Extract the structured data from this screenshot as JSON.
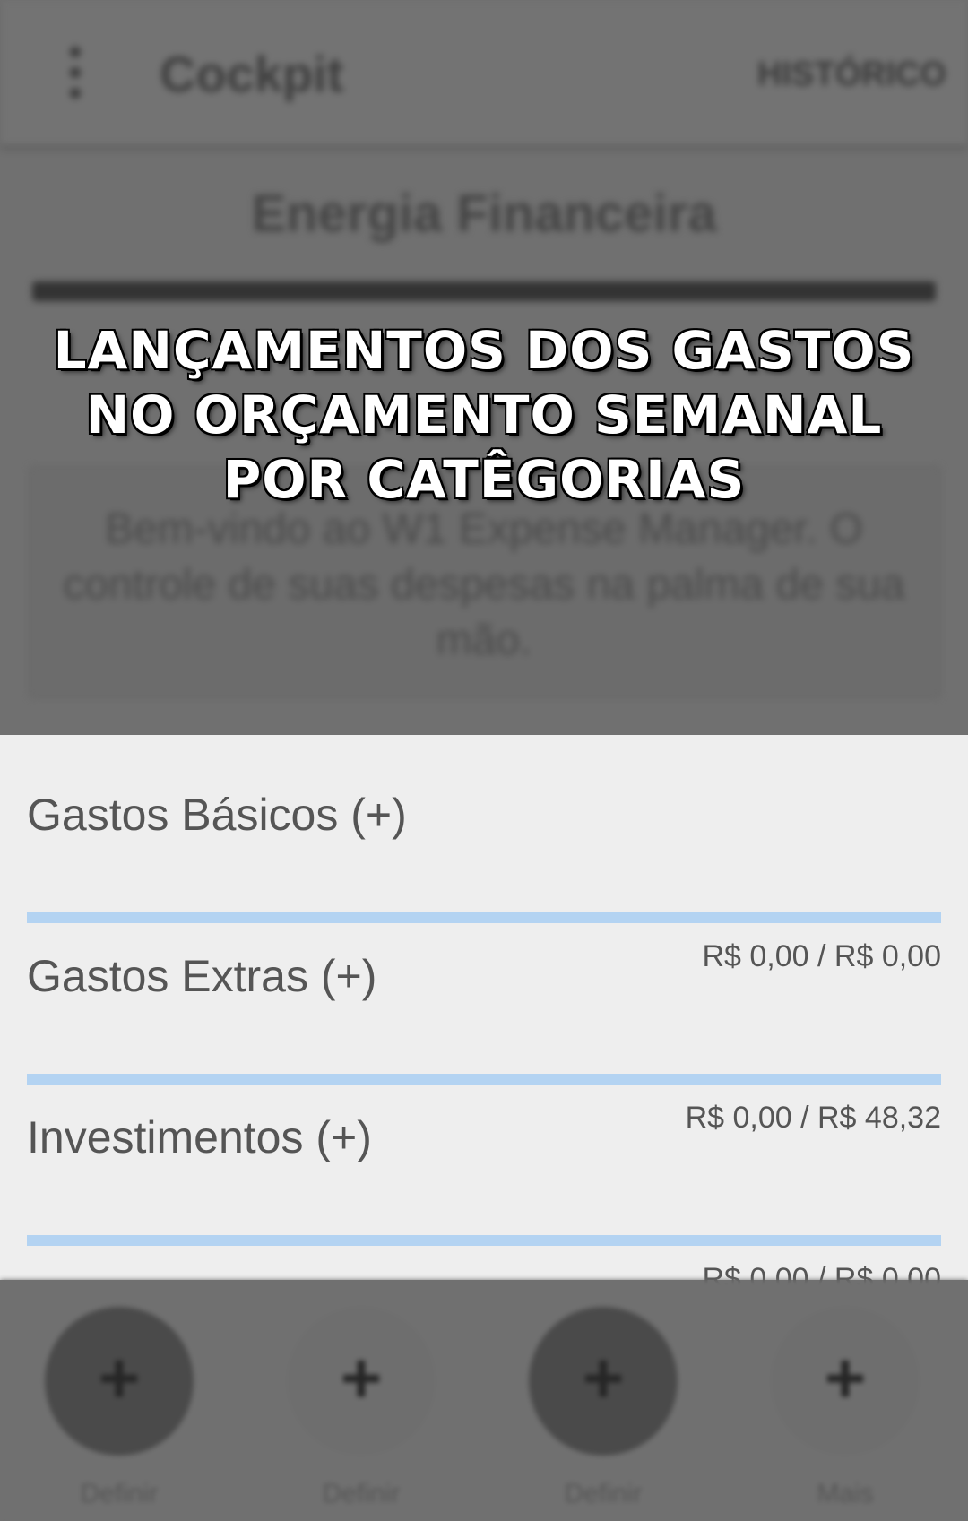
{
  "app_bar": {
    "title": "Cockpit",
    "history_label": "HISTÓRICO"
  },
  "main": {
    "section_title": "Energia Financeira",
    "welcome_message": "Bem-vindo ao W1 Expense Manager. O controle de suas despesas na palma de sua mão."
  },
  "overlay_caption": {
    "lines": [
      "LANÇAMENTOS DOS GASTOS",
      "NO ORÇAMENTO SEMANAL",
      "POR CATÊGORIAS"
    ]
  },
  "budget": {
    "categories": [
      {
        "label": "Gastos Básicos (+)",
        "amount": "R$ 0,00 / R$ 0,00",
        "progress": 0
      },
      {
        "label": "Gastos Extras (+)",
        "amount": "R$ 0,00 / R$ 48,32",
        "progress": 0
      },
      {
        "label": "Investimentos (+)",
        "amount": "R$ 0,00 / R$ 0,00",
        "progress": 0
      }
    ]
  },
  "bottom_buttons": [
    {
      "icon": "plus-icon",
      "glyph": "+",
      "label": "Definir",
      "color": "#4a4a4a"
    },
    {
      "icon": "plus-icon",
      "glyph": "+",
      "label": "Definir",
      "color": "#6e6e6e"
    },
    {
      "icon": "plus-icon",
      "glyph": "+",
      "label": "Definir",
      "color": "#4a4a4a"
    },
    {
      "icon": "plus-icon",
      "glyph": "+",
      "label": "Mais",
      "color": "#6e6e6e"
    }
  ],
  "colors": {
    "dim_overlay": "#707070",
    "panel_background": "#eeeeee",
    "progress_track": "#b3d3f2",
    "text": "#555555"
  }
}
